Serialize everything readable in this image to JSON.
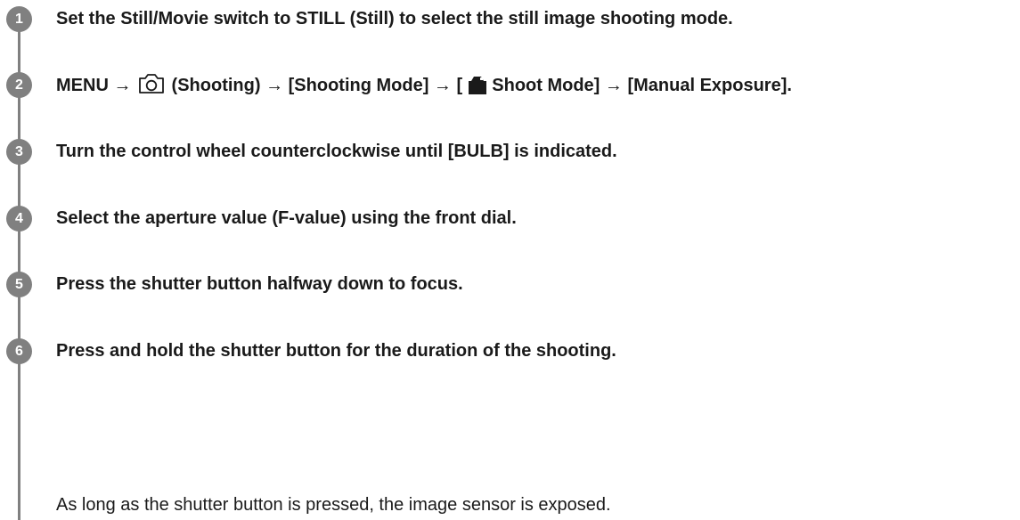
{
  "steps": [
    {
      "number": "1",
      "text": "Set the Still/Movie switch to STILL (Still) to select the still image shooting mode."
    },
    {
      "number": "2",
      "parts": {
        "a": "MENU → ",
        "b": " (Shooting) → [Shooting Mode] → [ ",
        "c": " Shoot Mode] → [Manual Exposure]."
      },
      "icons": [
        "camera-outline-icon",
        "camera-filled-icon"
      ]
    },
    {
      "number": "3",
      "text": "Turn the control wheel counterclockwise until [BULB] is indicated."
    },
    {
      "number": "4",
      "text": "Select the aperture value (F-value) using the front dial."
    },
    {
      "number": "5",
      "text": "Press the shutter button halfway down to focus."
    },
    {
      "number": "6",
      "text": "Press and hold the shutter button for the duration of the shooting."
    }
  ],
  "note": "As long as the shutter button is pressed, the image sensor is exposed.",
  "colors": {
    "badge": "#808080",
    "text": "#1a1a1a",
    "background": "#ffffff"
  }
}
